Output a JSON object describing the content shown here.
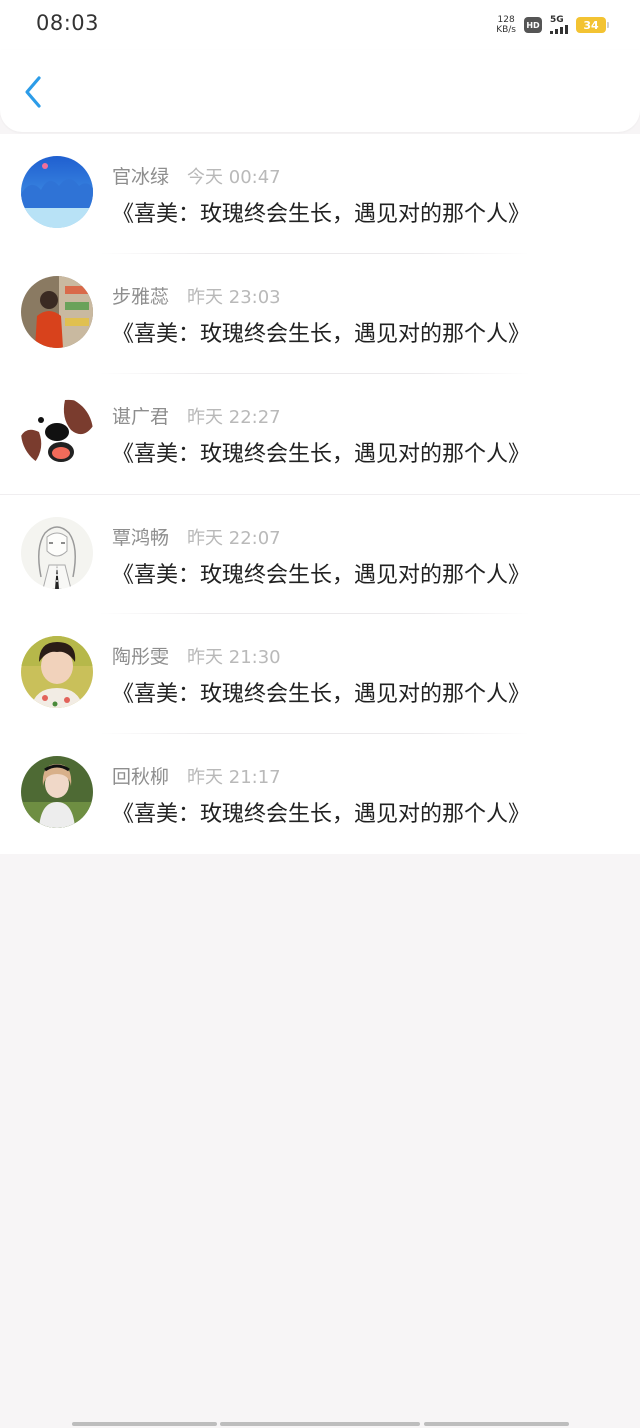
{
  "status_bar": {
    "time": "08:03",
    "net_speed_value": "128",
    "net_speed_unit": "KB/s",
    "hd_label": "HD",
    "signal_label": "5G",
    "battery_level": "34"
  },
  "header": {
    "back_icon": "chevron-left-icon",
    "accent_color": "#2c9ce8"
  },
  "messages": [
    {
      "name": "官冰绿",
      "time": "今天 00:47",
      "text": "《喜美：玫瑰终会生长，遇见对的那个人》"
    },
    {
      "name": "步雅蕊",
      "time": "昨天 23:03",
      "text": "《喜美：玫瑰终会生长，遇见对的那个人》"
    },
    {
      "name": "谌广君",
      "time": "昨天 22:27",
      "text": "《喜美：玫瑰终会生长，遇见对的那个人》"
    },
    {
      "name": "覃鸿畅",
      "time": "昨天 22:07",
      "text": "《喜美：玫瑰终会生长，遇见对的那个人》"
    },
    {
      "name": "陶彤雯",
      "time": "昨天 21:30",
      "text": "《喜美：玫瑰终会生长，遇见对的那个人》"
    },
    {
      "name": "回秋柳",
      "time": "昨天 21:17",
      "text": "《喜美：玫瑰终会生长，遇见对的那个人》"
    }
  ]
}
